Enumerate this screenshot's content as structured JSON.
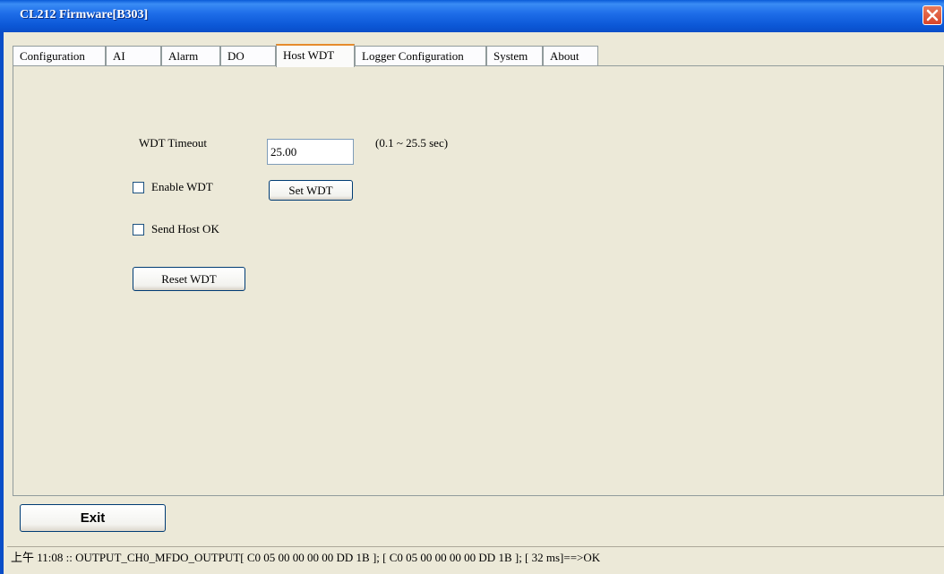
{
  "window": {
    "title": "CL212 Firmware[B303]"
  },
  "tabs": [
    {
      "label": "Configuration"
    },
    {
      "label": "AI"
    },
    {
      "label": "Alarm"
    },
    {
      "label": "DO"
    },
    {
      "label": "Host WDT"
    },
    {
      "label": "Logger Configuration"
    },
    {
      "label": "System"
    },
    {
      "label": "About"
    }
  ],
  "active_tab": "Host WDT",
  "host_wdt": {
    "timeout_label": "WDT Timeout",
    "timeout_value": "25.00",
    "range_hint": "(0.1 ~ 25.5 sec)",
    "enable_label": "Enable WDT",
    "enable_checked": false,
    "set_button": "Set WDT",
    "send_ok_label": "Send Host OK",
    "send_ok_checked": false,
    "reset_button": "Reset WDT"
  },
  "footer": {
    "exit_label": "Exit"
  },
  "status": {
    "text": "上午 11:08 :: OUTPUT_CH0_MFDO_OUTPUT[ C0 05 00 00 00 00 DD 1B ]; [ C0 05 00 00 00 00 DD 1B  ]; [ 32 ms]==>OK"
  },
  "colors": {
    "title_bar": "#0a5bd8",
    "active_tab_accent": "#e68b2c",
    "panel_bg": "#ece9d8",
    "close_button": "#d8452a"
  }
}
